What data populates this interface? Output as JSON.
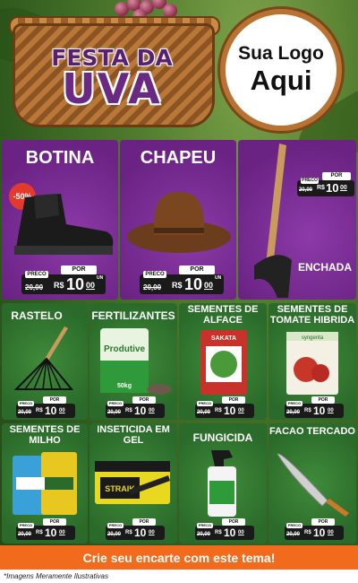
{
  "header": {
    "title_line1": "FESTA DA",
    "title_line2": "UVA",
    "logo_line1": "Sua Logo",
    "logo_line2": "Aqui"
  },
  "price_labels": {
    "preco": "PRECO",
    "por": "POR",
    "old": "20,00",
    "currency": "R$",
    "value_int": "10",
    "value_cents": "00",
    "unit": "UN"
  },
  "products": [
    {
      "name": "BOTINA",
      "discount": "-50%"
    },
    {
      "name": "CHAPEU"
    },
    {
      "name": "ENCHADA"
    },
    {
      "name": "RASTELO"
    },
    {
      "name": "FERTILIZANTES",
      "package_text": "Produtive",
      "package_weight": "50kg"
    },
    {
      "name": "SEMENTES DE ALFACE",
      "package_brand": "SAKATA"
    },
    {
      "name": "SEMENTES DE TOMATE HIBRIDA",
      "package_brand": "syngenta"
    },
    {
      "name": "SEMENTES DE MILHO"
    },
    {
      "name": "INSETICIDA EM GEL",
      "package_text": "STRAIK"
    },
    {
      "name": "FUNGICIDA"
    },
    {
      "name": "FACAO TERCADO"
    }
  ],
  "cta": "Crie seu encarte com este tema!",
  "footnote": "*Imagens Meramente Ilustrativas",
  "colors": {
    "purple": "#6a2383",
    "green": "#2a6a2a",
    "cta": "#f26a1b",
    "badge": "#e43a2c"
  }
}
